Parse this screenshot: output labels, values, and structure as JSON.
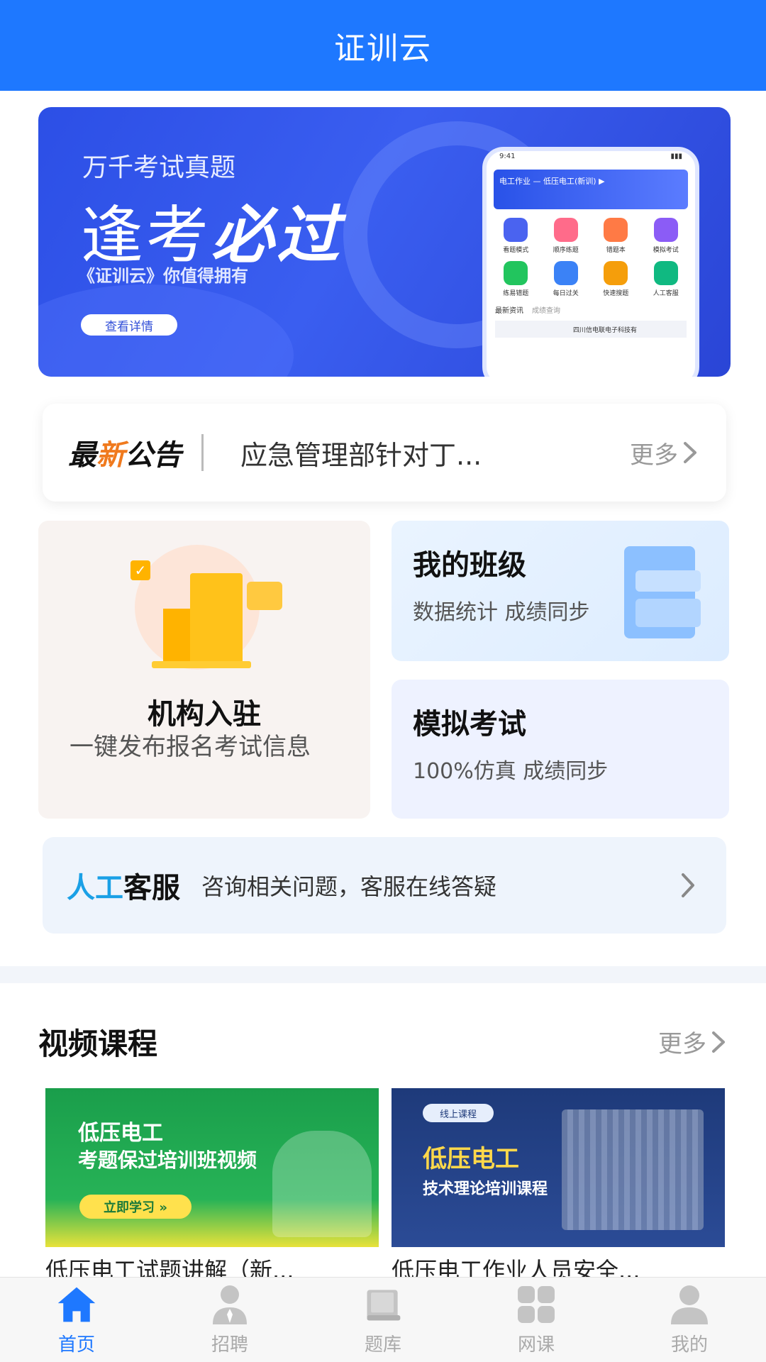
{
  "header": {
    "title": "证训云"
  },
  "banner": {
    "subtitle": "万千考试真题",
    "headline_plain": "逢考",
    "headline_bold": "必过",
    "slogan": "《证训云》你值得拥有",
    "cta": "查看详情",
    "phone": {
      "time": "9:41",
      "bar_title": "电工作业 — 低压电工(新训) ▶",
      "grid": [
        {
          "label": "看题模式",
          "color": "#4a63f0"
        },
        {
          "label": "顺序练题",
          "color": "#ff6b8a"
        },
        {
          "label": "错题本",
          "color": "#ff7a45"
        },
        {
          "label": "模拟考试",
          "color": "#8b5cf6"
        },
        {
          "label": "练易错题",
          "color": "#22c55e"
        },
        {
          "label": "每日过关",
          "color": "#3b82f6"
        },
        {
          "label": "快速搜题",
          "color": "#f59e0b"
        },
        {
          "label": "人工客服",
          "color": "#10b981"
        }
      ],
      "tabs": [
        "最新资讯",
        "成绩查询"
      ],
      "news": "四川信电联电子科技有"
    }
  },
  "notice": {
    "tag_a": "最",
    "tag_b": "新",
    "tag_c": "公告",
    "text": "应急管理部针对丁...",
    "more": "更多"
  },
  "cards": {
    "org": {
      "title": "机构入驻",
      "desc": "一键发布报名考试信息"
    },
    "class": {
      "title": "我的班级",
      "desc": "数据统计 成绩同步"
    },
    "exam": {
      "title": "模拟考试",
      "desc": "100%仿真 成绩同步"
    }
  },
  "service": {
    "tag_blue": "人工",
    "tag_black": "客服",
    "text": "咨询相关问题，客服在线答疑"
  },
  "courses": {
    "title": "视频课程",
    "more": "更多",
    "items": [
      {
        "thumb_line1": "低压电工",
        "thumb_line2": "考题保过培训班视频",
        "thumb_button": "立即学习 »",
        "name": "低压电工试题讲解（新..."
      },
      {
        "thumb_chip": "线上课程",
        "thumb_line1": "低压电工",
        "thumb_line2": "技术理论培训课程",
        "name": "低压电工作业人员安全..."
      }
    ]
  },
  "tabbar": {
    "items": [
      {
        "label": "首页",
        "icon": "home-icon",
        "active": true
      },
      {
        "label": "招聘",
        "icon": "person-tie-icon",
        "active": false
      },
      {
        "label": "题库",
        "icon": "book-icon",
        "active": false
      },
      {
        "label": "网课",
        "icon": "grid-icon",
        "active": false
      },
      {
        "label": "我的",
        "icon": "user-icon",
        "active": false
      }
    ],
    "active_color": "#1e78ff",
    "inactive_color": "#bbbbbb"
  }
}
